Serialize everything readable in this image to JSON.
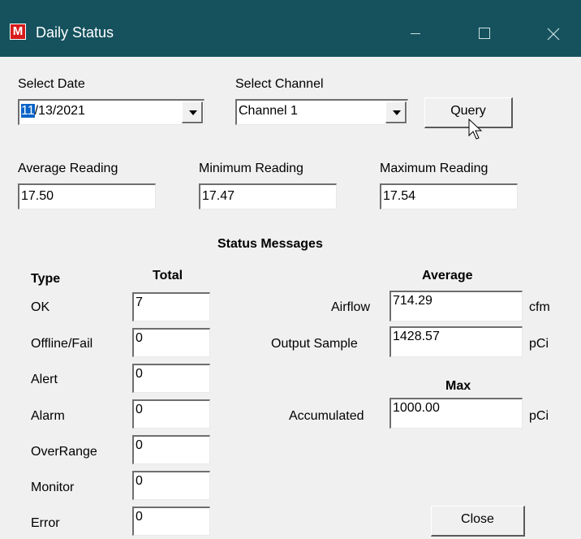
{
  "window": {
    "title": "Daily Status",
    "app_icon_letter": "M"
  },
  "date": {
    "label": "Select Date",
    "value_selected": "11",
    "value_rest": "/13/2021"
  },
  "channel": {
    "label": "Select Channel",
    "value": "Channel 1"
  },
  "query_button": "Query",
  "readings": {
    "average": {
      "label": "Average Reading",
      "value": "17.50"
    },
    "minimum": {
      "label": "Minimum Reading",
      "value": "17.47"
    },
    "maximum": {
      "label": "Maximum Reading",
      "value": "17.54"
    }
  },
  "status": {
    "heading": "Status Messages",
    "type_header": "Type",
    "total_header": "Total",
    "rows": [
      {
        "type": "OK",
        "total": "7"
      },
      {
        "type": "Offline/Fail",
        "total": "0"
      },
      {
        "type": "Alert",
        "total": "0"
      },
      {
        "type": "Alarm",
        "total": "0"
      },
      {
        "type": "OverRange",
        "total": "0"
      },
      {
        "type": "Monitor",
        "total": "0"
      },
      {
        "type": "Error",
        "total": "0"
      }
    ]
  },
  "average": {
    "header": "Average",
    "airflow": {
      "label": "Airflow",
      "value": "714.29",
      "unit": "cfm"
    },
    "output_sample": {
      "label": "Output Sample",
      "value": "1428.57",
      "unit": "pCi"
    }
  },
  "max": {
    "header": "Max",
    "accumulated": {
      "label": "Accumulated",
      "value": "1000.00",
      "unit": "pCi"
    }
  },
  "close_button": "Close",
  "colors": {
    "titlebar": "#15525e",
    "app_icon": "#d71a1a",
    "selection": "#0a64c8",
    "window_bg": "#f0f0f0"
  }
}
